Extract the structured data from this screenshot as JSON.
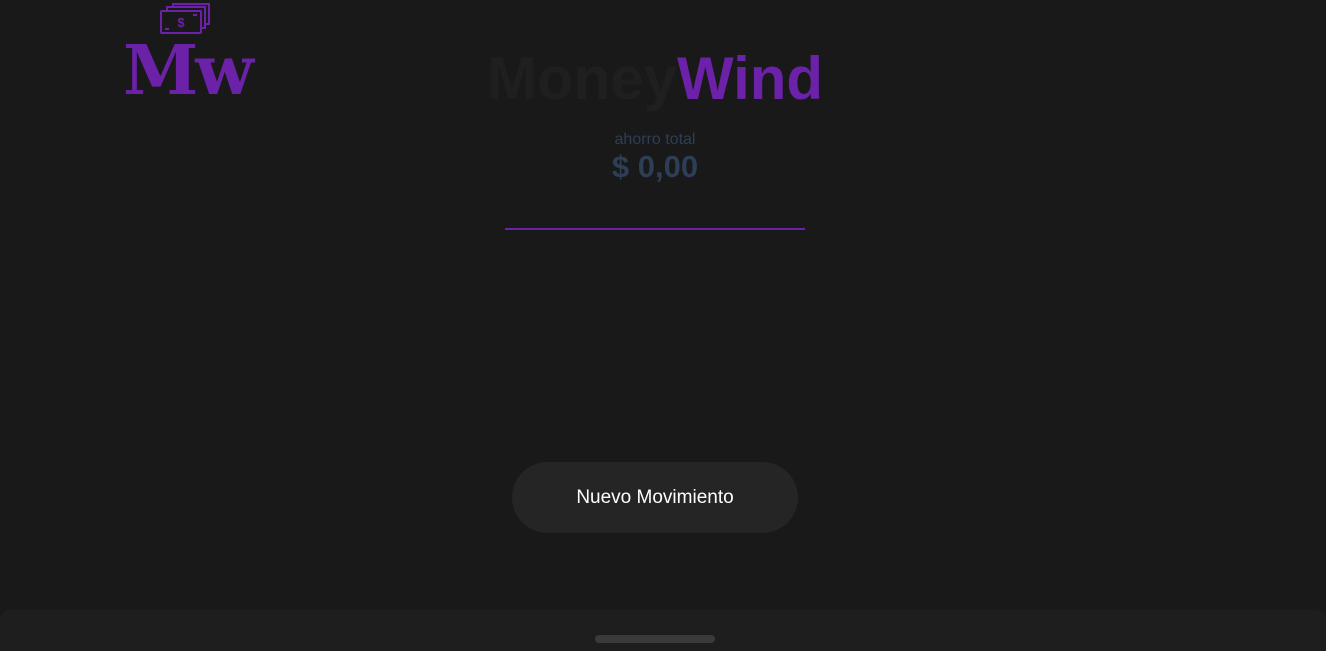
{
  "colors": {
    "background": "#191919",
    "accent_purple": "#6b21a8",
    "brand_dark": "#1f1f1f",
    "savings_text": "#2f3e57"
  },
  "logo": {
    "icon": "money-bills-icon",
    "text": "Mw"
  },
  "brand": {
    "part1": "Money",
    "part2": "Wind"
  },
  "savings": {
    "label": "ahorro total",
    "amount": "$ 0,00"
  },
  "actions": {
    "new_movement_label": "Nuevo Movimiento"
  }
}
